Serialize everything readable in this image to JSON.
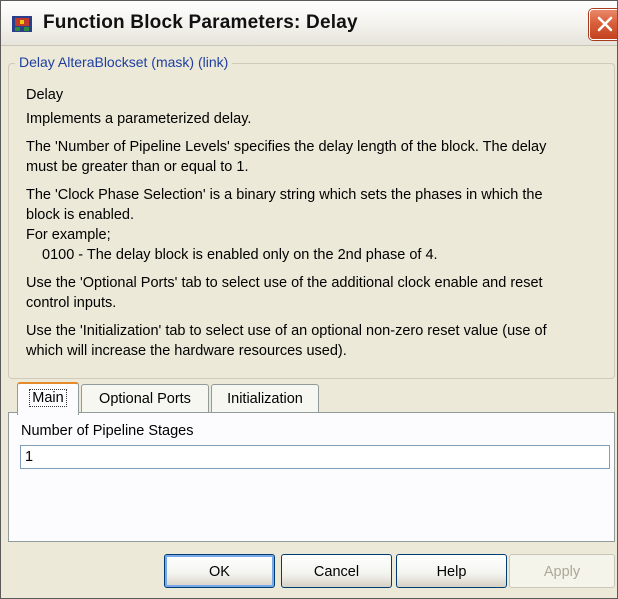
{
  "window": {
    "title": "Function Block Parameters: Delay"
  },
  "group": {
    "legend": "Delay AlteraBlockset (mask) (link)"
  },
  "description": {
    "line1": "Delay",
    "line2": "Implements a parameterized delay.",
    "line3": "The 'Number of Pipeline Levels' specifies the delay length of the block. The delay",
    "line4": "must be greater than or equal to 1.",
    "line5": "The 'Clock Phase Selection' is a binary string which sets the phases in which the",
    "line6": "block is enabled.",
    "line7": "For example;",
    "line8": "0100 - The delay block is enabled only on the 2nd phase of 4.",
    "line9": "Use the 'Optional Ports' tab to select use of the additional clock enable and reset",
    "line10": "control inputs.",
    "line11": "Use the 'Initialization' tab to select use of an optional non-zero reset value (use of",
    "line12": "which will increase the hardware resources used)."
  },
  "tabs": [
    {
      "label": "Main"
    },
    {
      "label": "Optional Ports"
    },
    {
      "label": "Initialization"
    }
  ],
  "main_tab": {
    "field_label": "Number of Pipeline Stages",
    "field_value": "1"
  },
  "buttons": {
    "ok": "OK",
    "cancel": "Cancel",
    "help": "Help",
    "apply": "Apply"
  },
  "icons": {
    "app": "simulink-block-icon",
    "close": "close-icon"
  },
  "colors": {
    "window_bg": "#ece9d8",
    "legend_text": "#1e3fa0",
    "close_red": "#d9603b",
    "active_tab_accent": "#e68b2c"
  }
}
